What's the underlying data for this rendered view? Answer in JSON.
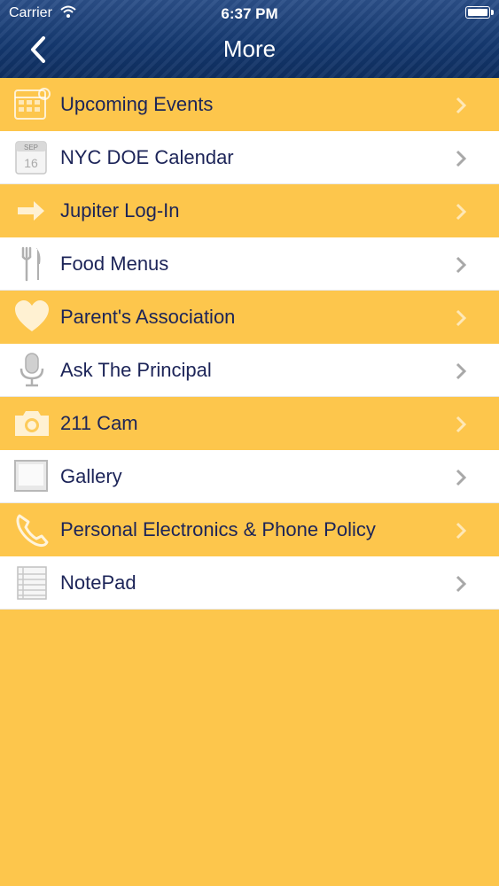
{
  "status_bar": {
    "carrier": "Carrier",
    "time": "6:37 PM"
  },
  "nav": {
    "title": "More",
    "back_icon": "chevron-left-icon"
  },
  "menu": {
    "items": [
      {
        "label": "Upcoming Events",
        "icon": "calendar-grid-icon"
      },
      {
        "label": "NYC DOE Calendar",
        "icon": "calendar-page-icon"
      },
      {
        "label": "Jupiter Log-In",
        "icon": "arrow-right-icon"
      },
      {
        "label": "Food Menus",
        "icon": "fork-knife-icon"
      },
      {
        "label": "Parent's Association",
        "icon": "heart-icon"
      },
      {
        "label": "Ask The Principal",
        "icon": "microphone-icon"
      },
      {
        "label": "211 Cam",
        "icon": "camera-icon"
      },
      {
        "label": "Gallery",
        "icon": "picture-frame-icon"
      },
      {
        "label": "Personal Electronics & Phone Policy",
        "icon": "phone-handset-icon"
      },
      {
        "label": "NotePad",
        "icon": "notepad-icon"
      }
    ]
  },
  "colors": {
    "accent_yellow": "#fdc64c",
    "header_blue": "#14386f",
    "label_navy": "#1c2458"
  }
}
